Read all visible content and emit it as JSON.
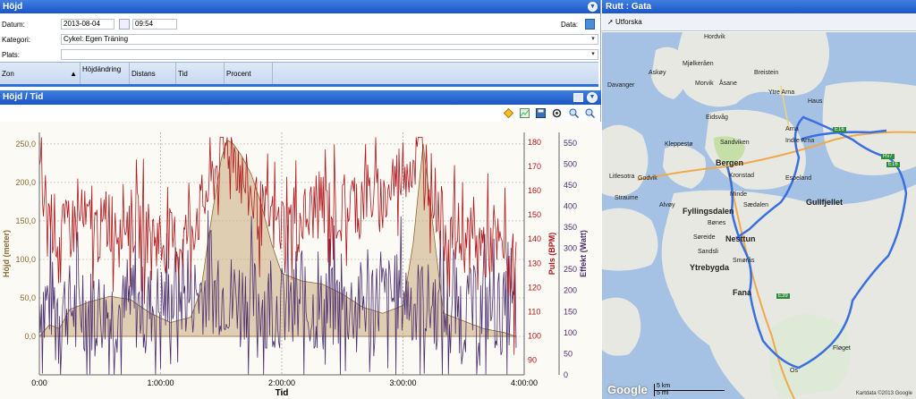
{
  "left_panel": {
    "title": "Höjd",
    "form": {
      "date_label": "Datum:",
      "date_value": "2013-08-04",
      "time_value": "09:54",
      "data_label": "Data:",
      "category_label": "Kategori:",
      "category_value": "Cykel: Egen Träning",
      "place_label": "Plats:",
      "place_value": ""
    },
    "columns": [
      "Zon",
      "Höjdändring",
      "Distans",
      "Tid",
      "Procent"
    ],
    "chart_section_title": "Höjd / Tid"
  },
  "chart_data": {
    "type": "area",
    "title": "",
    "xlabel": "Tid",
    "x_ticks": [
      "0:00",
      "1:00:00",
      "2:00:00",
      "3:00:00",
      "4:00:00"
    ],
    "xlim_minutes": [
      0,
      240
    ],
    "axes": {
      "left": {
        "label": "Höjd (meter)",
        "ticks": [
          "0,0",
          "50,0",
          "100,0",
          "150,0",
          "200,0",
          "250,0"
        ],
        "range": [
          -50,
          265
        ],
        "color": "#8b6a33"
      },
      "puls": {
        "label": "Puls (BPM)",
        "ticks": [
          "90",
          "100",
          "110",
          "120",
          "130",
          "140",
          "150",
          "160",
          "170",
          "180"
        ],
        "range": [
          84,
          184
        ],
        "color": "#b0161b"
      },
      "effekt": {
        "label": "Effekt (Watt)",
        "ticks": [
          "0",
          "50",
          "100",
          "150",
          "200",
          "250",
          "300",
          "350",
          "400",
          "450",
          "500",
          "550"
        ],
        "range": [
          0,
          575
        ],
        "color": "#4b2e6e"
      }
    },
    "series": [
      {
        "name": "Höjd",
        "color": "#caa97a",
        "x": [
          0,
          5,
          10,
          15,
          25,
          35,
          45,
          55,
          65,
          75,
          80,
          85,
          90,
          93,
          96,
          100,
          105,
          110,
          115,
          120,
          130,
          140,
          150,
          160,
          170,
          180,
          185,
          190,
          200,
          210,
          220,
          230,
          236
        ],
        "y": [
          0,
          15,
          10,
          35,
          45,
          52,
          48,
          30,
          18,
          25,
          60,
          150,
          230,
          255,
          250,
          235,
          210,
          170,
          120,
          82,
          72,
          68,
          55,
          38,
          30,
          40,
          120,
          250,
          30,
          20,
          10,
          5,
          0
        ]
      },
      {
        "name": "Puls",
        "color": "#b0161b",
        "x": [
          0,
          10,
          20,
          30,
          40,
          50,
          60,
          70,
          80,
          90,
          95,
          100,
          110,
          120,
          130,
          140,
          150,
          160,
          170,
          180,
          190,
          200,
          210,
          220,
          230,
          236
        ],
        "y": [
          162,
          140,
          148,
          143,
          150,
          145,
          140,
          138,
          152,
          175,
          180,
          165,
          150,
          145,
          148,
          155,
          150,
          160,
          155,
          170,
          175,
          145,
          140,
          138,
          135,
          118
        ]
      },
      {
        "name": "Effekt",
        "color": "#4b2e6e",
        "x": [
          0,
          20,
          40,
          60,
          80,
          100,
          120,
          140,
          160,
          180,
          200,
          220,
          236
        ],
        "y": [
          180,
          160,
          150,
          170,
          200,
          190,
          160,
          150,
          170,
          190,
          150,
          160,
          140
        ]
      }
    ]
  },
  "right_panel": {
    "title": "Rutt : Gata",
    "explore_label": "Utforska",
    "map_labels": [
      "Hordvik",
      "Askøy",
      "Mjølkeråen",
      "Breistein",
      "Davanger",
      "Morvik",
      "Åsane",
      "Ytre Arna",
      "Haus",
      "Kleppestø",
      "Eidsvåg",
      "Sandviken",
      "Arna",
      "Indre Arna",
      "Bergen",
      "Kronstad",
      "Espeland",
      "Godvik",
      "Litlesotra",
      "Straume",
      "Minde",
      "Sædalen",
      "Alvøy",
      "Fyllingsdalen",
      "Bønes",
      "Gullfjellet",
      "Søreide",
      "Nesttun",
      "Sandsli",
      "Ytrebygda",
      "Smørås",
      "Fana",
      "Fløget",
      "Os"
    ],
    "road_labels": [
      "E16",
      "E39",
      "Rv7",
      "E16"
    ],
    "scale_km": "5 km",
    "scale_mi": "5 mi",
    "google": "Google",
    "attribution": "Kartdata ©2013 Google"
  }
}
